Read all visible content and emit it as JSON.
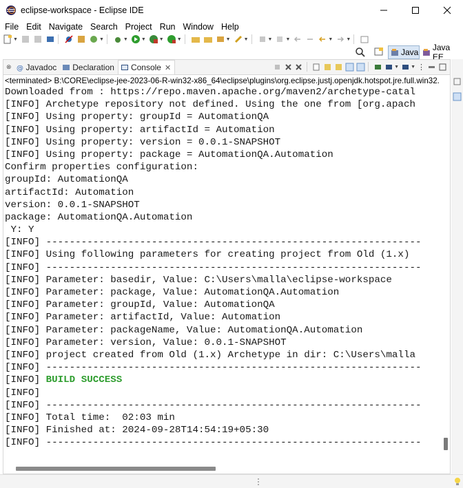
{
  "window": {
    "title": "eclipse-workspace - Eclipse IDE"
  },
  "menu": [
    "File",
    "Edit",
    "Navigate",
    "Search",
    "Project",
    "Run",
    "Window",
    "Help"
  ],
  "perspectives": {
    "java": "Java",
    "javaee": "Java EE"
  },
  "tabs": {
    "javadoc": "Javadoc",
    "declaration": "Declaration",
    "console": "Console"
  },
  "console": {
    "terminated_label": "<terminated> B:\\CORE\\eclipse-jee-2023-06-R-win32-x86_64\\eclipse\\plugins\\org.eclipse.justj.openjdk.hotspot.jre.full.win32.",
    "lines": [
      "Downloaded from : https://repo.maven.apache.org/maven2/archetype-catal",
      "[INFO] Archetype repository not defined. Using the one from [org.apach",
      "[INFO] Using property: groupId = AutomationQA",
      "[INFO] Using property: artifactId = Automation",
      "[INFO] Using property: version = 0.0.1-SNAPSHOT",
      "[INFO] Using property: package = AutomationQA.Automation",
      "Confirm properties configuration:",
      "groupId: AutomationQA",
      "artifactId: Automation",
      "version: 0.0.1-SNAPSHOT",
      "package: AutomationQA.Automation",
      " Y: Y",
      "[INFO] ----------------------------------------------------------------",
      "[INFO] Using following parameters for creating project from Old (1.x)",
      "[INFO] ----------------------------------------------------------------",
      "[INFO] Parameter: basedir, Value: C:\\Users\\malla\\eclipse-workspace",
      "[INFO] Parameter: package, Value: AutomationQA.Automation",
      "[INFO] Parameter: groupId, Value: AutomationQA",
      "[INFO] Parameter: artifactId, Value: Automation",
      "[INFO] Parameter: packageName, Value: AutomationQA.Automation",
      "[INFO] Parameter: version, Value: 0.0.1-SNAPSHOT",
      "[INFO] project created from Old (1.x) Archetype in dir: C:\\Users\\malla",
      "[INFO] ----------------------------------------------------------------",
      "[INFO] ",
      "[INFO] ----------------------------------------------------------------",
      "[INFO] Total time:  02:03 min",
      "[INFO] Finished at: 2024-09-28T14:54:19+05:30",
      "[INFO] ----------------------------------------------------------------"
    ],
    "success_prefix": "[INFO] ",
    "success_text": "BUILD SUCCESS",
    "success_line_index": 23
  },
  "colors": {
    "success": "#2e9d2e",
    "active_perspective": "#d9e6f5"
  }
}
